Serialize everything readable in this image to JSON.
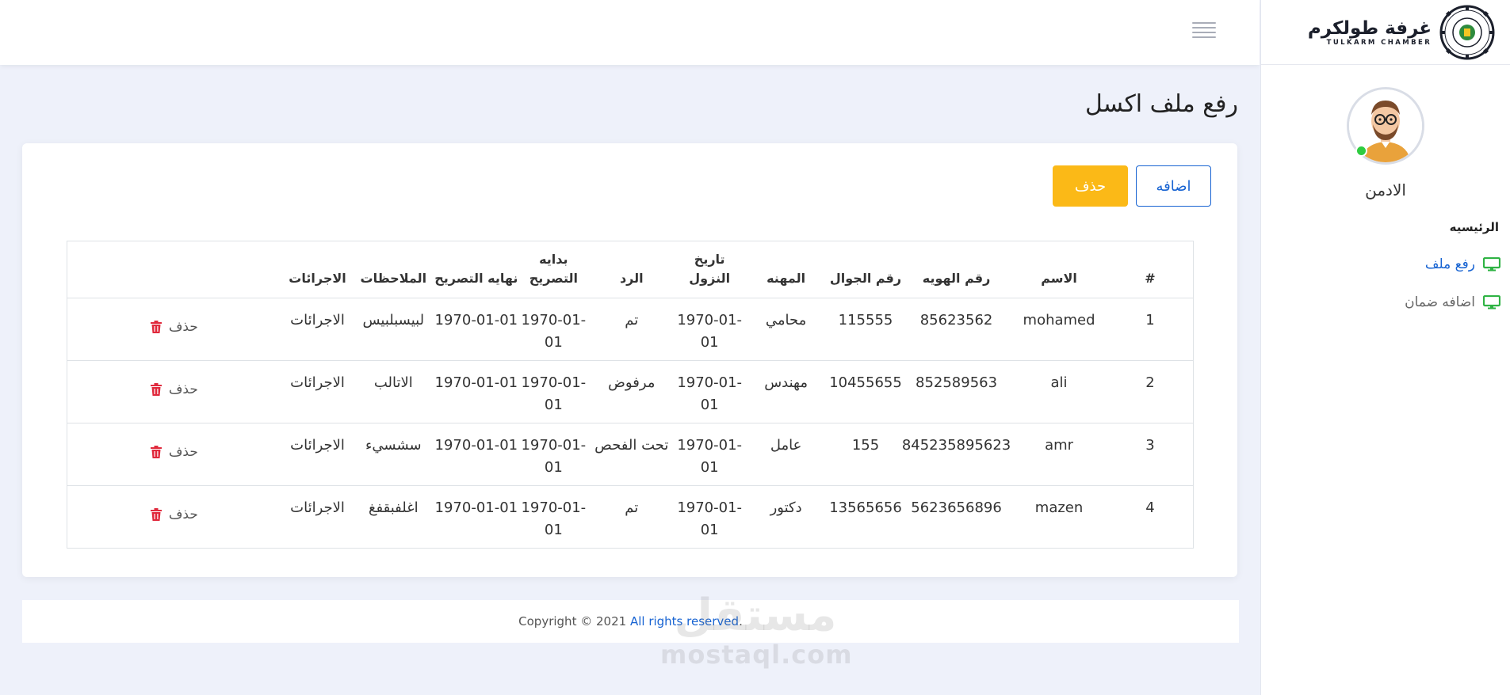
{
  "brand": {
    "name_ar": "غرفة طولكرم",
    "name_en": "TULKARM CHAMBER"
  },
  "profile": {
    "name": "الادمن"
  },
  "nav": {
    "heading": "الرئيسيه",
    "items": [
      {
        "label": "رفع ملف",
        "active": true
      },
      {
        "label": "اضافه ضمان",
        "active": false
      }
    ]
  },
  "page": {
    "title": "رفع ملف اكسل"
  },
  "toolbar": {
    "add_label": "اضافه",
    "delete_label": "حذف"
  },
  "table": {
    "headers": [
      "#",
      "الاسم",
      "رقم الهويه",
      "رقم الجوال",
      "المهنه",
      "تاريخ النزول",
      "الرد",
      "بدايه التصريح",
      "نهايه التصريح",
      "الملاحظات",
      "الاجرائات",
      ""
    ],
    "delete_label": "حذف",
    "rows": [
      [
        "1",
        "mohamed",
        "85623562",
        "115555",
        "محامي",
        "1970-01-01",
        "تم",
        "1970-01-01",
        "1970-01-01",
        "لبيسبلبيس",
        "الاجرائات"
      ],
      [
        "2",
        "ali",
        "852589563",
        "10455655",
        "مهندس",
        "1970-01-01",
        "مرفوض",
        "1970-01-01",
        "1970-01-01",
        "الاتالب",
        "الاجرائات"
      ],
      [
        "3",
        "amr",
        "845235895623",
        "155",
        "عامل",
        "1970-01-01",
        "تحت الفحص",
        "1970-01-01",
        "1970-01-01",
        "سشسيء",
        "الاجرائات"
      ],
      [
        "4",
        "mazen",
        "5623656896",
        "13565656",
        "دكتور",
        "1970-01-01",
        "تم",
        "1970-01-01",
        "1970-01-01",
        "اغلفبقفغ",
        "الاجرائات"
      ]
    ]
  },
  "footer": {
    "prefix": "Copyright © 2021",
    "link": "All rights reserved",
    "suffix": "."
  },
  "watermark": {
    "ar": "مستقل",
    "en": "mostaql.com"
  },
  "colors": {
    "primary": "#1763d2",
    "warning": "#fbb917",
    "danger": "#e0293c",
    "success": "#2ecc40"
  }
}
